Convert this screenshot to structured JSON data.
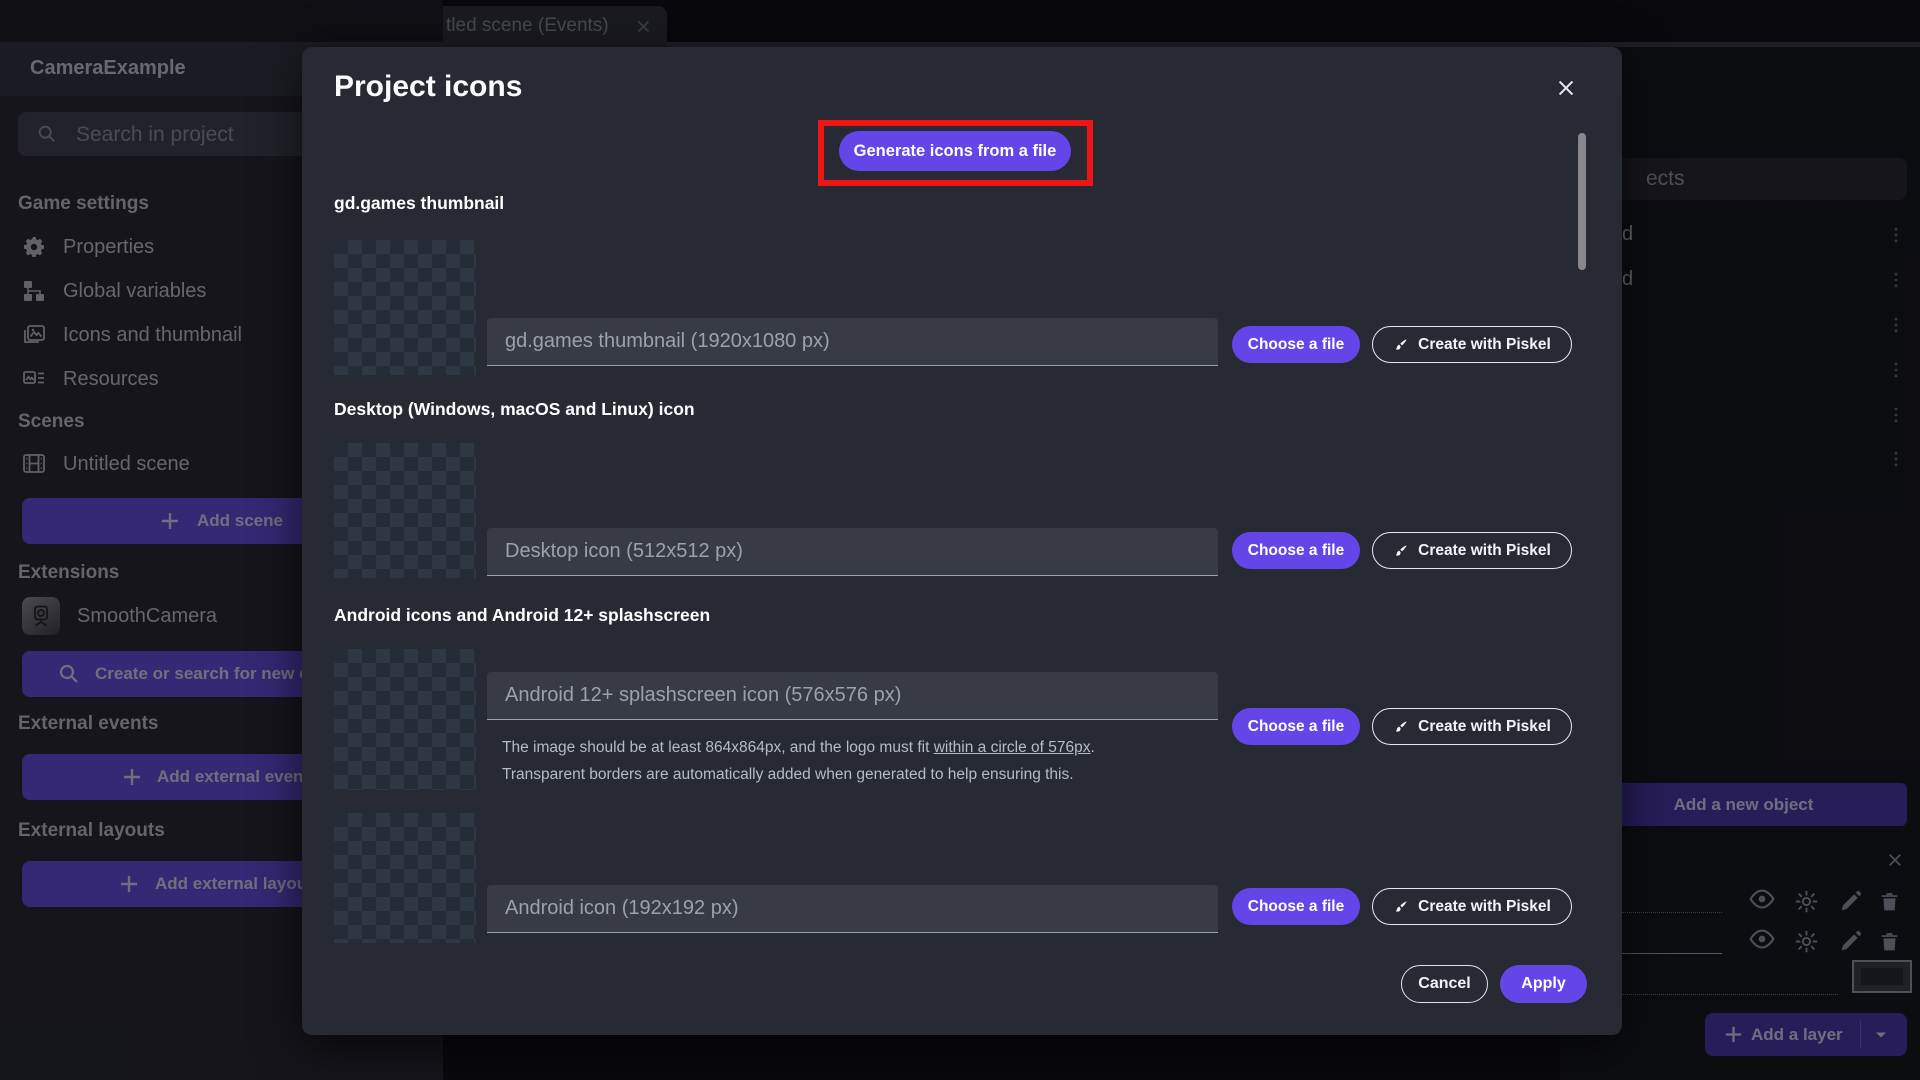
{
  "colors": {
    "accent_purple": "#6445e8",
    "annotation_red": "#ee1515",
    "checker_light": "#2e3842",
    "checker_dark": "#242c35"
  },
  "tab_bar": {
    "active_tab_fragment": "tled scene (Events)"
  },
  "project_manager": {
    "title": "CameraExample",
    "search_placeholder": "Search in project",
    "sections": {
      "game_settings": "Game settings",
      "scenes": "Scenes",
      "extensions": "Extensions",
      "external_events": "External events",
      "external_layouts": "External layouts"
    },
    "items": {
      "properties": "Properties",
      "global_variables": "Global variables",
      "icons_and_thumbnail": "Icons and thumbnail",
      "resources": "Resources",
      "untitled_scene": "Untitled scene",
      "smooth_camera": "SmoothCamera"
    },
    "buttons": {
      "add_scene": "Add scene",
      "search_extensions_fragment": "Create or search for new e",
      "add_external_events_fragment": "Add external even",
      "add_external_layouts_fragment": "Add external layou"
    }
  },
  "objects_panel": {
    "search_fragment": "ects",
    "row_fragments": [
      "d",
      "d"
    ],
    "add_object": "Add a new object"
  },
  "layers_panel": {
    "add_layer": "Add a layer"
  },
  "modal": {
    "title": "Project icons",
    "generate_button": "Generate icons from a file",
    "choose_file": "Choose a file",
    "create_with_piskel": "Create with Piskel",
    "sections": [
      {
        "heading": "gd.games thumbnail",
        "placeholder": "gd.games thumbnail (1920x1080 px)"
      },
      {
        "heading": "Desktop (Windows, macOS and Linux) icon",
        "placeholder": "Desktop icon (512x512 px)"
      },
      {
        "heading": "Android icons and Android 12+ splashscreen",
        "placeholder": "Android 12+ splashscreen icon (576x576 px)",
        "help_pre": "The image should be at least 864x864px, and the logo must fit ",
        "help_link": "within a circle of 576px",
        "help_post": ".",
        "help_line2": "Transparent borders are automatically added when generated to help ensuring this."
      },
      {
        "placeholder": "Android icon (192x192 px)"
      }
    ],
    "cancel": "Cancel",
    "apply": "Apply"
  }
}
